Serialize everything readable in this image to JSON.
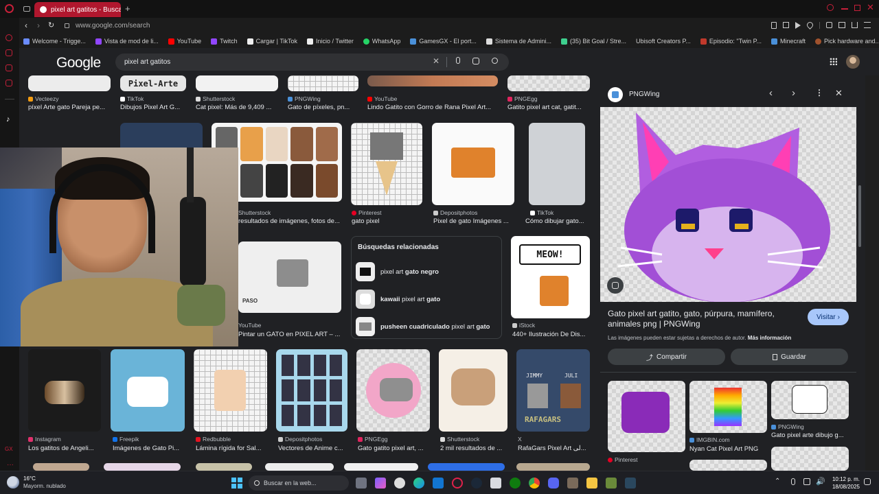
{
  "browser": {
    "tab_title": "pixel art gatitos - Buscar c",
    "url": "www.google.com/search",
    "bookmarks": [
      {
        "label": "Welcome - Trigge...",
        "color": "#6a8cff"
      },
      {
        "label": "Vista de mod de li...",
        "color": "#9146ff"
      },
      {
        "label": "YouTube",
        "color": "#ff0000"
      },
      {
        "label": "Twitch",
        "color": "#9146ff"
      },
      {
        "label": "Cargar | TikTok",
        "color": "#ffffff"
      },
      {
        "label": "Inicio / Twitter",
        "color": "#ffffff"
      },
      {
        "label": "WhatsApp",
        "color": "#25d366"
      },
      {
        "label": "GamesGX - El port...",
        "color": "#4a90d9"
      },
      {
        "label": "Sistema de Admini...",
        "color": "#dddddd"
      },
      {
        "label": "(35) Bit Goal / Stre...",
        "color": "#3ecf8e"
      },
      {
        "label": "Ubisoft Creators P...",
        "color": "#1c1c1c"
      },
      {
        "label": "Episodio: \"Twin P...",
        "color": "#c0392b"
      },
      {
        "label": "Minecraft",
        "color": "#4a90d9"
      },
      {
        "label": "Pick hardware and...",
        "color": "#a0522d"
      }
    ]
  },
  "google": {
    "logo": "Google",
    "query": "pixel art gatitos"
  },
  "results": {
    "row1": [
      {
        "source": "Vecteezy",
        "title": "píxel Arte gato Pareja pe...",
        "color": "#f39c12"
      },
      {
        "source": "TikTok",
        "title": "Dibujos Pixel Art G...",
        "color": "#ffffff",
        "thumb_text": "Pixel-Arte"
      },
      {
        "source": "Shutterstock",
        "title": "Cat pixel: Más de 9,409 ...",
        "color": "#dddddd"
      },
      {
        "source": "PNGWing",
        "title": "Gato de píxeles, pn...",
        "color": "#4a90d9"
      },
      {
        "source": "YouTube",
        "title": "Lindo Gatito con Gorro de Rana Pixel Art...",
        "color": "#ff0000"
      },
      {
        "source": "PNGEgg",
        "title": "Gatito pixel art cat, gatit...",
        "color": "#e0245e"
      }
    ],
    "row2": [
      {
        "source": "Shutterstock",
        "title": "resultados de imágenes, fotos de...",
        "color": "#dddddd"
      },
      {
        "source": "Pinterest",
        "title": "gato pixel",
        "color": "#e60023"
      },
      {
        "source": "Depositphotos",
        "title": "Pixel de gato Imágenes ...",
        "color": "#cccccc"
      },
      {
        "source": "TikTok",
        "title": "Cómo dibujar gato...",
        "color": "#ffffff"
      }
    ],
    "row3": [
      {
        "source": "YouTube",
        "title": "Pintar un GATO en PIXEL ART – ...",
        "color": "#ff0000",
        "thumb_text": "PASO"
      },
      {
        "source": "iStock",
        "title": "440+ Ilustración De Dis...",
        "color": "#cccccc",
        "thumb_text": "MEOW!"
      }
    ],
    "row4": [
      {
        "source": "Instagram",
        "title": "Los gatitos de Angeli...",
        "color": "#e1306c"
      },
      {
        "source": "Freepik",
        "title": "Imágenes de Gato Pi...",
        "color": "#1273eb"
      },
      {
        "source": "Redbubble",
        "title": "Lámina rígida for Sal...",
        "color": "#e41321"
      },
      {
        "source": "Depositphotos",
        "title": "Vectores de Anime c...",
        "color": "#cccccc"
      },
      {
        "source": "PNGEgg",
        "title": "Gato gatito pixel art, ...",
        "color": "#e0245e"
      },
      {
        "source": "Shutterstock",
        "title": "2 mil resultados de ...",
        "color": "#dddddd"
      },
      {
        "source": "X",
        "title": "RafaGars Pixel Art لی...",
        "color": "#ffffff"
      }
    ],
    "rafa_text": {
      "left": "JIMMY",
      "right": "JULI",
      "bottom": "RAFAGARS"
    }
  },
  "related": {
    "heading": "Búsquedas relacionadas",
    "items": [
      {
        "pre": "pixel art ",
        "bold": "gato negro",
        "post": ""
      },
      {
        "pre": "",
        "bold": "kawaii",
        "post": " pixel art ",
        "bold2": "gato"
      },
      {
        "pre": "",
        "bold": "pusheen cuadriculado",
        "post": " pixel art ",
        "bold2": "gato"
      }
    ]
  },
  "panel": {
    "site": "PNGWing",
    "title": "Gato pixel art gatito, gato, púrpura, mamífero, animales png | PNGWing",
    "visit": "Visitar",
    "notice": "Las imágenes pueden estar sujetas a derechos de autor.",
    "more_info": "Más información",
    "share": "Compartir",
    "save": "Guardar",
    "similar": [
      {
        "source": "Pinterest",
        "title": "",
        "color": "#e60023"
      },
      {
        "source": "IMGBIN.com",
        "title": "Nyan Cat Pixel Art PNG",
        "color": "#4a90d9"
      },
      {
        "source": "PNGWing",
        "title": "Gato pixel arte dibujo g...",
        "color": "#4a90d9"
      }
    ]
  },
  "taskbar": {
    "weather_temp": "16°C",
    "weather_desc": "Mayorm. nublado",
    "search_placeholder": "Buscar en la web...",
    "time": "10:12 p. m.",
    "date": "18/08/2025"
  }
}
